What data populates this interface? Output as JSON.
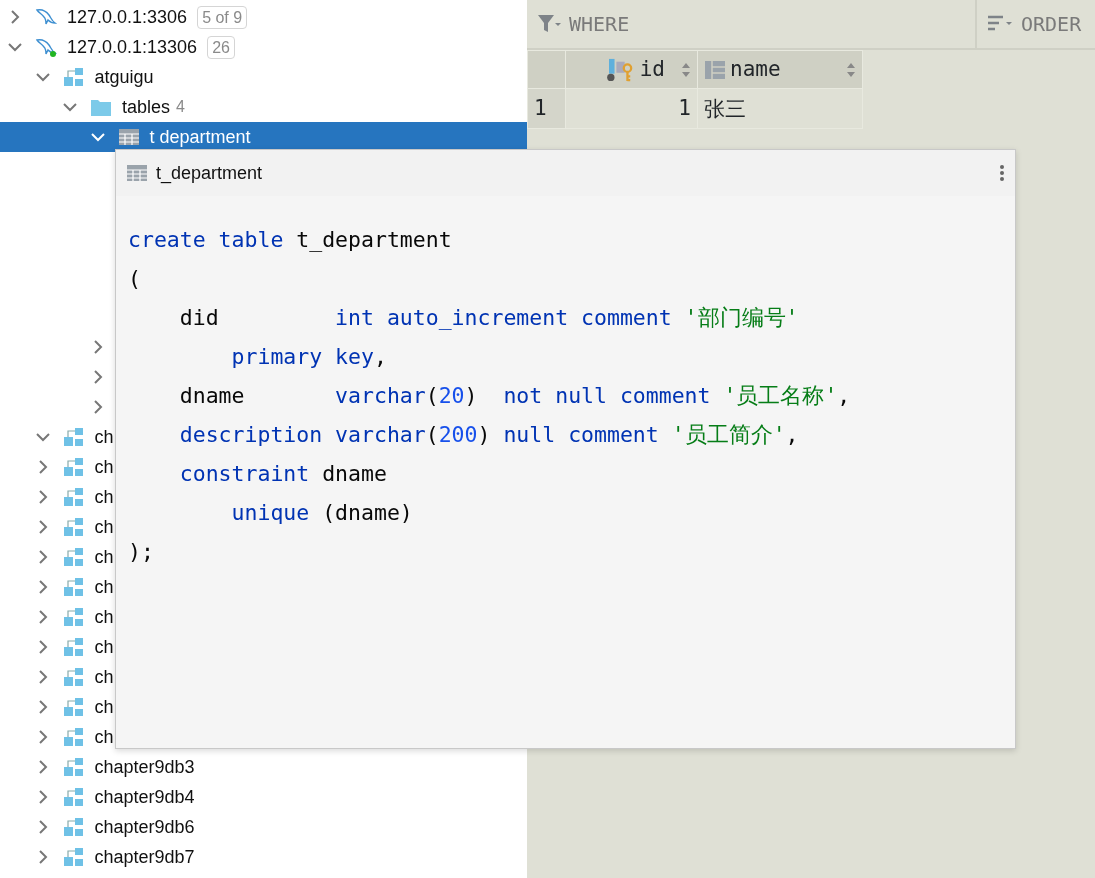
{
  "tree": [
    {
      "kind": "server",
      "label": "127.0.0.1:3306",
      "badge": "5 of 9",
      "expanded": false,
      "connected": false
    },
    {
      "kind": "server",
      "label": "127.0.0.1:13306",
      "badge": "26",
      "expanded": true,
      "connected": true,
      "children": [
        {
          "kind": "schema",
          "label": "atguigu",
          "expanded": true,
          "selected": false,
          "children": [
            {
              "kind": "folder",
              "label": "tables",
              "count": "4",
              "expanded": true,
              "selected": false,
              "children": [
                {
                  "kind": "table",
                  "label": "t department",
                  "expanded": true,
                  "selected": true
                },
                {
                  "expanded": false,
                  "selected": false
                },
                {
                  "expanded": false,
                  "selected": false
                },
                {
                  "expanded": false,
                  "selected": false
                }
              ]
            }
          ]
        },
        {
          "kind": "schema",
          "label": "ch",
          "expanded": true,
          "selected": false
        },
        {
          "kind": "schema",
          "label": "ch",
          "expanded": false,
          "selected": false
        },
        {
          "kind": "schema",
          "label": "ch",
          "expanded": false,
          "selected": false
        },
        {
          "kind": "schema",
          "label": "ch",
          "expanded": false,
          "selected": false
        },
        {
          "kind": "schema",
          "label": "ch",
          "expanded": false,
          "selected": false
        },
        {
          "kind": "schema",
          "label": "ch",
          "expanded": false,
          "selected": false
        },
        {
          "kind": "schema",
          "label": "ch",
          "expanded": false,
          "selected": false
        },
        {
          "kind": "schema",
          "label": "ch",
          "expanded": false,
          "selected": false
        },
        {
          "kind": "schema",
          "label": "ch",
          "expanded": false,
          "selected": false
        },
        {
          "kind": "schema",
          "label": "ch",
          "expanded": false,
          "selected": false
        },
        {
          "kind": "schema",
          "label": "ch",
          "expanded": false,
          "selected": false
        },
        {
          "kind": "schema",
          "label": "chapter9db3",
          "expanded": false,
          "selected": false
        },
        {
          "kind": "schema",
          "label": "chapter9db4",
          "expanded": false,
          "selected": false
        },
        {
          "kind": "schema",
          "label": "chapter9db6",
          "expanded": false,
          "selected": false
        },
        {
          "kind": "schema",
          "label": "chapter9db7",
          "expanded": false,
          "selected": false
        }
      ]
    }
  ],
  "filter_bar": {
    "where": "WHERE",
    "order": "ORDER"
  },
  "grid": {
    "columns": [
      {
        "label": "id",
        "kind": "key"
      },
      {
        "label": "name",
        "kind": "column"
      }
    ],
    "rows": [
      {
        "number": "1",
        "cells": [
          "1",
          "张三"
        ]
      }
    ]
  },
  "popup": {
    "title": "t_department",
    "code": [
      [
        {
          "text": "create table",
          "kind": "keyword"
        },
        {
          "text": " t_department",
          "kind": "plain"
        }
      ],
      [
        {
          "text": "(",
          "kind": "plain"
        }
      ],
      [
        {
          "text": "    did         ",
          "kind": "plain"
        },
        {
          "text": "int auto_increment comment",
          "kind": "keyword"
        },
        {
          "text": " '部门编号'",
          "kind": "string"
        }
      ],
      [
        {
          "text": "        primary key",
          "kind": "keyword"
        },
        {
          "text": ",",
          "kind": "plain"
        }
      ],
      [
        {
          "text": "    dname       ",
          "kind": "plain"
        },
        {
          "text": "varchar",
          "kind": "keyword"
        },
        {
          "text": "(",
          "kind": "plain"
        },
        {
          "text": "20",
          "kind": "number"
        },
        {
          "text": ")  ",
          "kind": "plain"
        },
        {
          "text": "not null comment",
          "kind": "keyword"
        },
        {
          "text": " '员工名称'",
          "kind": "string"
        },
        {
          "text": ",",
          "kind": "plain"
        }
      ],
      [
        {
          "text": "    description varchar",
          "kind": "keyword"
        },
        {
          "text": "(",
          "kind": "plain"
        },
        {
          "text": "200",
          "kind": "number"
        },
        {
          "text": ") ",
          "kind": "plain"
        },
        {
          "text": "null comment",
          "kind": "keyword"
        },
        {
          "text": " '员工简介'",
          "kind": "string"
        },
        {
          "text": ",",
          "kind": "plain"
        }
      ],
      [
        {
          "text": "    constraint",
          "kind": "keyword"
        },
        {
          "text": " dname",
          "kind": "plain"
        }
      ],
      [
        {
          "text": "        unique",
          "kind": "keyword"
        },
        {
          "text": " (dname)",
          "kind": "plain"
        }
      ],
      [
        {
          "text": ");",
          "kind": "plain"
        }
      ]
    ]
  }
}
